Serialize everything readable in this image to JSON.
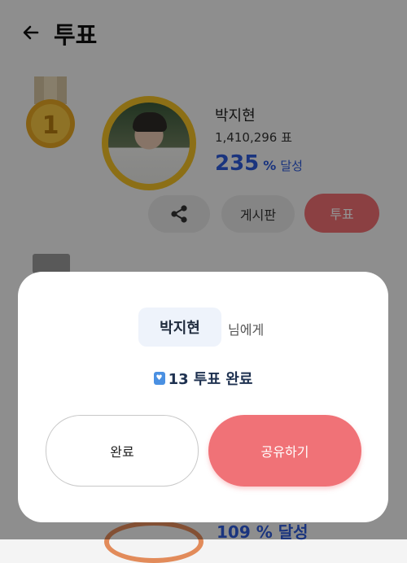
{
  "header": {
    "title": "투표"
  },
  "candidate": {
    "rank": "1",
    "name": "박지현",
    "votes": "1,410,296 표",
    "percent": "235",
    "percent_unit": "%",
    "percent_label": "달성"
  },
  "actions": {
    "board_label": "게시판",
    "vote_label": "투표"
  },
  "background_next": {
    "percent_text": "109 % 달성"
  },
  "modal": {
    "recipient": "박지현",
    "recipient_suffix": "님에게",
    "heart_icon": "heart-icon",
    "done_text": "13 투표 완료",
    "done_button": "완료",
    "share_button": "공유하기"
  },
  "colors": {
    "accent": "#ef6f73",
    "percent": "#2e5bd9",
    "gold": "#f2c027"
  }
}
